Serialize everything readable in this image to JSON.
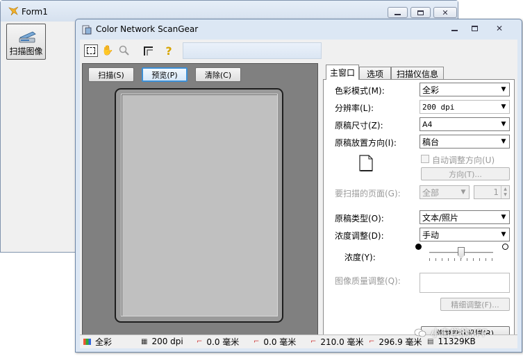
{
  "form1": {
    "title": "Form1",
    "scan_button_label": "扫描图像"
  },
  "scangear": {
    "title": "Color Network ScanGear",
    "toolbar": {
      "icons": [
        "marquee-select-icon",
        "hand-pan-icon",
        "zoom-icon",
        "crop-corner-icon",
        "help-icon"
      ]
    },
    "preview_buttons": {
      "scan": "扫描(S)",
      "preview": "预览(P)",
      "clear": "清除(C)"
    },
    "tabs": {
      "main": "主窗口",
      "options": "选项",
      "scanner_info": "扫描仪信息"
    },
    "main_tab": {
      "color_mode_label": "色彩模式(M):",
      "color_mode_value": "全彩",
      "resolution_label": "分辨率(L):",
      "resolution_value": "200 dpi",
      "original_size_label": "原稿尺寸(Z):",
      "original_size_value": "A4",
      "orientation_label": "原稿放置方向(I):",
      "orientation_value": "稿台",
      "auto_rotate_label": "自动调整方向(U)",
      "direction_button": "方向(T)...",
      "pages_label": "要扫描的页面(G):",
      "pages_value": "全部",
      "pages_spin_value": "1",
      "original_type_label": "原稿类型(O):",
      "original_type_value": "文本/照片",
      "density_adjust_label": "浓度调整(D):",
      "density_adjust_value": "手动",
      "density_label": "浓度(Y):",
      "density_level": 0.5,
      "image_quality_label": "图像质量调整(Q):",
      "fine_adjust_button": "精细调整(F)...",
      "restore_defaults_button": "恢复默认设置(R)"
    },
    "status_bar": {
      "color": "全彩",
      "dpi": "200 dpi",
      "x_offset": "0.0 毫米",
      "y_offset": "0.0 毫米",
      "width": "210.0 毫米",
      "height": "296.9 毫米",
      "size": "11329KB"
    }
  },
  "watermark": "小白学的VFP",
  "colors": {
    "titlebar": "#dce7f4",
    "preview_bg": "#808080",
    "page_fill": "#c0c0c0",
    "dialog_bg": "#f0f0f0"
  }
}
